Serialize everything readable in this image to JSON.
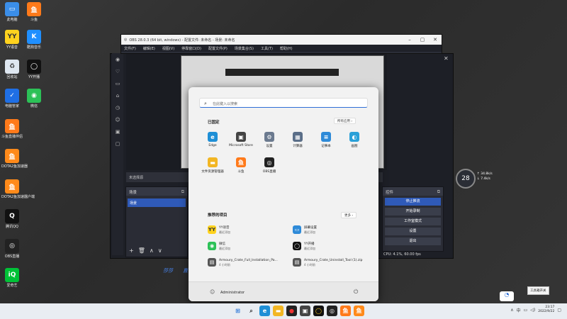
{
  "desktop": {
    "icons": [
      {
        "label": "此电脑",
        "glyph": "▭",
        "bg": "#3b8ee8"
      },
      {
        "label": "斗鱼",
        "glyph": "鱼",
        "bg": "#ff7a1a"
      },
      {
        "label": "YY语音",
        "glyph": "YY",
        "bg": "#ffd21e"
      },
      {
        "label": "酷狗音乐",
        "glyph": "K",
        "bg": "#1f8fff"
      },
      {
        "label": "回收站",
        "glyph": "♻",
        "bg": "#dfe7f0"
      },
      {
        "label": "YY开播",
        "glyph": "◯",
        "bg": "#111111"
      },
      {
        "label": "电脑管家",
        "glyph": "✓",
        "bg": "#1f6fe5"
      },
      {
        "label": "微信",
        "glyph": "◉",
        "bg": "#2cc157"
      },
      {
        "label": "斗鱼直播伴侣",
        "glyph": "鱼",
        "bg": "#ff7a1a"
      },
      {
        "label": "DOTA2鱼加速器",
        "glyph": "鱼",
        "bg": "#ff8a1a"
      },
      {
        "label": "DOTA2鱼加速器户端",
        "glyph": "鱼",
        "bg": "#ff8a1a"
      },
      {
        "label": "腾讯QQ",
        "glyph": "Q",
        "bg": "#111111"
      },
      {
        "label": "OBS直播",
        "glyph": "◎",
        "bg": "#222222"
      },
      {
        "label": "爱奇艺",
        "glyph": "iQ",
        "bg": "#00c237"
      }
    ]
  },
  "obs": {
    "title": "OBS 28.0.3 (64 bit, windows) - 配置文件: 未命名 - 场景: 未命名",
    "menu": [
      "文件(F)",
      "编辑(E)",
      "视图(V)",
      "停靠窗口(D)",
      "配置文件(P)",
      "场景集合(S)",
      "工具(T)",
      "帮助(H)"
    ],
    "no_source": "未选择源",
    "scenes_title": "场景",
    "scene_item": "场景",
    "controls_title": "控件",
    "controls": [
      "停止推流",
      "开始录制",
      "工作室模式",
      "设置",
      "退出"
    ],
    "status": "CPU: 4.1%, 60.00 fps",
    "blue_left": "莎莎",
    "blue_right": "直"
  },
  "start_menu": {
    "search_placeholder": "在此键入以搜索",
    "pinned_title": "已固定",
    "all_apps": "所有应用  ›",
    "pinned": [
      {
        "label": "Edge",
        "glyph": "e",
        "bg": "#1e8fd6"
      },
      {
        "label": "Microsoft Store",
        "glyph": "▣",
        "bg": "#444444"
      },
      {
        "label": "设置",
        "glyph": "⚙",
        "bg": "#6b7a8f"
      },
      {
        "label": "计算器",
        "glyph": "▦",
        "bg": "#5a6e88"
      },
      {
        "label": "记事本",
        "glyph": "≡",
        "bg": "#2e8ad8"
      },
      {
        "label": "画图",
        "glyph": "◐",
        "bg": "#2aa0d8"
      },
      {
        "label": "文件资源管理器",
        "glyph": "▬",
        "bg": "#f2b623"
      },
      {
        "label": "斗鱼",
        "glyph": "鱼",
        "bg": "#ff7a1a"
      },
      {
        "label": "OBS直播",
        "glyph": "◎",
        "bg": "#222222"
      }
    ],
    "recommended_title": "推荐的项目",
    "more": "更多  ›",
    "recommended": [
      {
        "title": "YY语音",
        "sub": "最近添加",
        "glyph": "YY",
        "bg": "#ffd21e"
      },
      {
        "title": "屏幕设置",
        "sub": "最近添加",
        "glyph": "▭",
        "bg": "#2e8ad8"
      },
      {
        "title": "微信",
        "sub": "最近添加",
        "glyph": "◉",
        "bg": "#2cc157"
      },
      {
        "title": "YY开播",
        "sub": "最近添加",
        "glyph": "◯",
        "bg": "#111111"
      },
      {
        "title": "Armoury_Crate_Full_Installation_Pa...",
        "sub": "4 小时前",
        "glyph": "▤",
        "bg": "#555555"
      },
      {
        "title": "Armoury_Crate_Uninstall_Tool (1).zip",
        "sub": "4 小时前",
        "glyph": "▤",
        "bg": "#555555"
      }
    ],
    "user": "Administrator"
  },
  "widget": {
    "value": "28",
    "up": "↑ 34.8k/s",
    "down": "↓ 7.4k/s"
  },
  "tooltip": "工具箱开关",
  "taskbar": {
    "time": "23:17",
    "date": "2022/9/22"
  }
}
